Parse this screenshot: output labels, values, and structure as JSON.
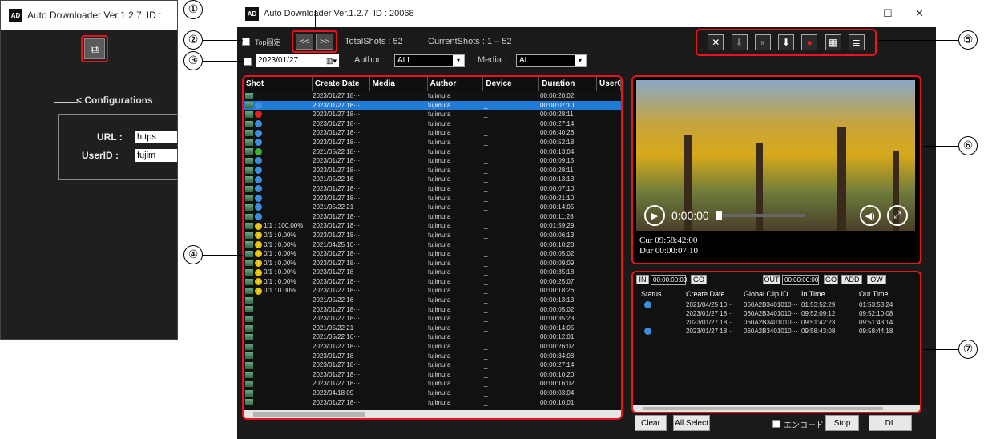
{
  "inset": {
    "app_title": "Auto Downloader Ver.1.2.7",
    "id_label": "ID :",
    "logo": "AD",
    "config_title": "< Configurations",
    "url_label": "URL :",
    "url_value": "https",
    "userid_label": "UserID :",
    "userid_value": "fujim"
  },
  "window": {
    "title": "Auto Downloader Ver.1.2.7",
    "id": "ID : 20068",
    "minimize": "–",
    "maximize": "☐",
    "close": "✕"
  },
  "toolbar": {
    "top_fix_label": "Top固定",
    "prev": "<<",
    "next": ">>",
    "total_shots": "TotalShots :  52",
    "current_shots": "CurrentShots :  1 – 52",
    "date": "2023/01/27",
    "author_label": "Author :",
    "author_value": "ALL",
    "media_label": "Media :",
    "media_value": "ALL",
    "icons": [
      "expand-icon",
      "download-disabled-icon",
      "pause-icon",
      "download-icon",
      "new-icon",
      "grid-view-icon",
      "list-view-icon"
    ]
  },
  "list": {
    "headers": [
      "Shot",
      "Create Date",
      "Media",
      "Author",
      "Device",
      "Duration",
      "UserC"
    ],
    "rows": [
      {
        "status": "",
        "info": "",
        "date": "2023/01/27 18···",
        "author": "fujimura",
        "device": "_",
        "duration": "00:00:20:02",
        "partial": true
      },
      {
        "status": "blue",
        "info": "",
        "date": "2023/01/27 18···",
        "author": "fujimura",
        "device": "_",
        "duration": "00:00:07:10",
        "selected": true
      },
      {
        "status": "red",
        "info": "",
        "date": "2023/01/27 18···",
        "author": "fujimura",
        "device": "_",
        "duration": "00:00:28:11"
      },
      {
        "status": "blue",
        "info": "",
        "date": "2023/01/27 18···",
        "author": "fujimura",
        "device": "_",
        "duration": "00:00:27:14"
      },
      {
        "status": "blue",
        "info": "",
        "date": "2023/01/27 18···",
        "author": "fujimura",
        "device": "_",
        "duration": "00:06:40:26"
      },
      {
        "status": "blue",
        "info": "",
        "date": "2023/01/27 18···",
        "author": "fujimura",
        "device": "_",
        "duration": "00:00:52:18"
      },
      {
        "status": "green",
        "info": "",
        "date": "2021/05/22 18···",
        "author": "fujimura",
        "device": "_",
        "duration": "00:00:13:04"
      },
      {
        "status": "blue",
        "info": "",
        "date": "2023/01/27 18···",
        "author": "fujimura",
        "device": "_",
        "duration": "00:00:09:15"
      },
      {
        "status": "blue",
        "info": "",
        "date": "2023/01/27 18···",
        "author": "fujimura",
        "device": "_",
        "duration": "00:00:28:11"
      },
      {
        "status": "blue",
        "info": "",
        "date": "2021/05/22 16···",
        "author": "fujimura",
        "device": "_",
        "duration": "00:00:13:13"
      },
      {
        "status": "blue",
        "info": "",
        "date": "2023/01/27 18···",
        "author": "fujimura",
        "device": "_",
        "duration": "00:00:07:10"
      },
      {
        "status": "blue",
        "info": "",
        "date": "2023/01/27 18···",
        "author": "fujimura",
        "device": "_",
        "duration": "00:00:21:10"
      },
      {
        "status": "blue",
        "info": "",
        "date": "2021/05/22 21···",
        "author": "fujimura",
        "device": "_",
        "duration": "00:00:14:05"
      },
      {
        "status": "blue",
        "info": "",
        "date": "2023/01/27 18···",
        "author": "fujimura",
        "device": "_",
        "duration": "00:00:11:28"
      },
      {
        "status": "yellow",
        "info": "1/1 : 100.00%",
        "date": "2023/01/27 18···",
        "author": "fujimura",
        "device": "_",
        "duration": "00:01:59:29"
      },
      {
        "status": "yellow",
        "info": "0/1 : 0.00%",
        "date": "2023/01/27 18···",
        "author": "fujimura",
        "device": "_",
        "duration": "00:00:06:13"
      },
      {
        "status": "yellow",
        "info": "0/1 : 0.00%",
        "date": "2021/04/25 10···",
        "author": "fujimura",
        "device": "_",
        "duration": "00:00:10:28"
      },
      {
        "status": "yellow",
        "info": "0/1 : 0.00%",
        "date": "2023/01/27 18···",
        "author": "fujimura",
        "device": "_",
        "duration": "00:00:05:02"
      },
      {
        "status": "yellow",
        "info": "0/1 : 0.00%",
        "date": "2023/01/27 18···",
        "author": "fujimura",
        "device": "_",
        "duration": "00:00:09:09"
      },
      {
        "status": "yellow",
        "info": "0/1 : 0.00%",
        "date": "2023/01/27 18···",
        "author": "fujimura",
        "device": "_",
        "duration": "00:00:35:18"
      },
      {
        "status": "yellow",
        "info": "0/1 : 0.00%",
        "date": "2023/01/27 18···",
        "author": "fujimura",
        "device": "_",
        "duration": "00:00:25:07"
      },
      {
        "status": "yellow",
        "info": "0/1 : 0.00%",
        "date": "2023/01/27 18···",
        "author": "fujimura",
        "device": "_",
        "duration": "00:00:18:26"
      },
      {
        "status": "",
        "info": "",
        "date": "2021/05/22 16···",
        "author": "fujimura",
        "device": "_",
        "duration": "00:00:13:13"
      },
      {
        "status": "",
        "info": "",
        "date": "2023/01/27 18···",
        "author": "fujimura",
        "device": "_",
        "duration": "00:00:05:02"
      },
      {
        "status": "",
        "info": "",
        "date": "2023/01/27 18···",
        "author": "fujimura",
        "device": "_",
        "duration": "00:00:35:23"
      },
      {
        "status": "",
        "info": "",
        "date": "2021/05/22 21···",
        "author": "fujimura",
        "device": "_",
        "duration": "00:00:14:05"
      },
      {
        "status": "",
        "info": "",
        "date": "2021/05/22 16···",
        "author": "fujimura",
        "device": "_",
        "duration": "00:00:12:01"
      },
      {
        "status": "",
        "info": "",
        "date": "2023/01/27 18···",
        "author": "fujimura",
        "device": "_",
        "duration": "00:00:26:02"
      },
      {
        "status": "",
        "info": "",
        "date": "2023/01/27 18···",
        "author": "fujimura",
        "device": "_",
        "duration": "00:00:34:08"
      },
      {
        "status": "",
        "info": "",
        "date": "2023/01/27 18···",
        "author": "fujimura",
        "device": "_",
        "duration": "00:00:27:14"
      },
      {
        "status": "",
        "info": "",
        "date": "2023/01/27 18···",
        "author": "fujimura",
        "device": "_",
        "duration": "00:00:10:20"
      },
      {
        "status": "",
        "info": "",
        "date": "2023/01/27 18···",
        "author": "fujimura",
        "device": "_",
        "duration": "00:00:16:02"
      },
      {
        "status": "",
        "info": "",
        "date": "2022/04/18 09···",
        "author": "fujimura",
        "device": "_",
        "duration": "00:00:03:04"
      },
      {
        "status": "",
        "info": "",
        "date": "2023/01/27 18···",
        "author": "fujimura",
        "device": "_",
        "duration": "00:00:10:01"
      }
    ]
  },
  "player": {
    "time": "0:00:00",
    "cur": "Cur 09:58:42:00",
    "dur": "Dur 00:00:07:10"
  },
  "clips": {
    "in_label": "IN",
    "in_tc": "00:00:00:00",
    "go": "GO",
    "out_label": "OUT",
    "out_tc": "00:00:00:00",
    "add": "ADD",
    "ow": "OW",
    "headers": [
      "Status",
      "Create Date",
      "Global Clip ID",
      "In Time",
      "Out Time"
    ],
    "rows": [
      {
        "status": "blue",
        "date": "2021/04/25 10···",
        "clip": "060A2B3401010···",
        "in": "01:53:52:29",
        "out": "01:53:53:24"
      },
      {
        "status": "",
        "date": "2023/01/27 18···",
        "clip": "060A2B3401010···",
        "in": "09:52:09:12",
        "out": "09:52:10:08"
      },
      {
        "status": "",
        "date": "2023/01/27 18···",
        "clip": "060A2B3401010···",
        "in": "09:51:42:23",
        "out": "09:51:43:14"
      },
      {
        "status": "blue",
        "date": "2023/01/27 18···",
        "clip": "060A2B3401010···",
        "in": "09:58:43:08",
        "out": "09:58:44:18"
      }
    ]
  },
  "bottom": {
    "clear": "Clear",
    "all_select": "All Select",
    "no_encode": "エンコードなし",
    "stop": "Stop",
    "dl": "DL"
  },
  "callouts": [
    "①",
    "②",
    "③",
    "④",
    "⑤",
    "⑥",
    "⑦"
  ],
  "colors": {
    "highlight": "#e8141e",
    "selected_row": "#1f7bd6",
    "status_blue": "#3b8fe0",
    "status_red": "#e02020",
    "status_green": "#3cb43c",
    "status_yellow": "#e6c200"
  }
}
